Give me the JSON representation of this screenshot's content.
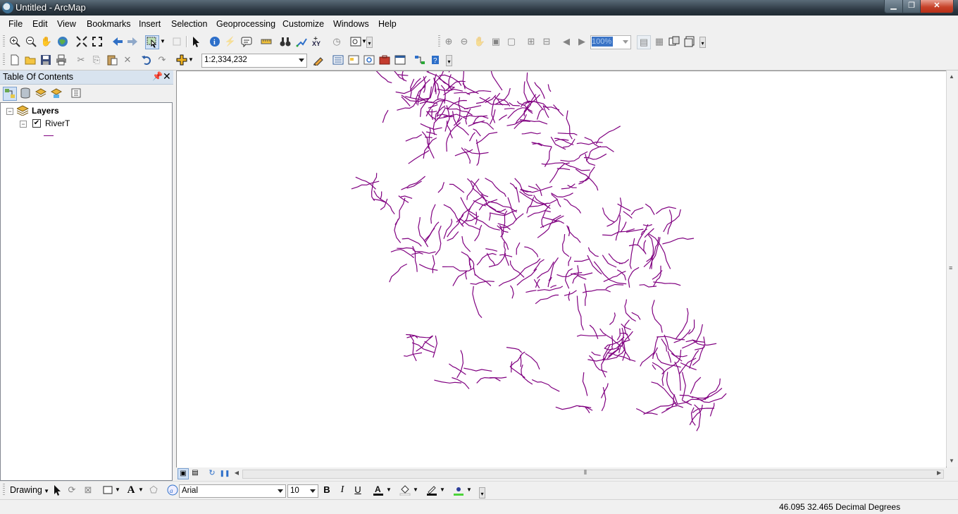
{
  "window": {
    "title": "Untitled - ArcMap"
  },
  "menu": [
    "File",
    "Edit",
    "View",
    "Bookmarks",
    "Insert",
    "Selection",
    "Geoprocessing",
    "Customize",
    "Windows",
    "Help"
  ],
  "standard_toolbar": {
    "scale": "1:2,334,232"
  },
  "layout_toolbar": {
    "zoom_percent": "100%"
  },
  "toc": {
    "title": "Table Of Contents",
    "root": {
      "label": "Layers",
      "expanded": true
    },
    "layers": [
      {
        "name": "RiverT",
        "visible": true,
        "symbol_color": "#800080"
      }
    ]
  },
  "map": {
    "feature_color": "#800080",
    "feature_type": "river polylines"
  },
  "drawing_toolbar": {
    "label": "Drawing",
    "font": "Arial",
    "font_size": "10"
  },
  "status": {
    "coords": "46.095  32.465 Decimal Degrees"
  },
  "icons": [
    "zoom-in-icon",
    "zoom-out-icon",
    "pan-icon",
    "full-extent-icon",
    "select-features-icon",
    "identify-icon",
    "find-icon",
    "add-data-icon",
    "undo-icon",
    "redo-icon",
    "bold-icon",
    "italic-icon",
    "underline-icon"
  ]
}
